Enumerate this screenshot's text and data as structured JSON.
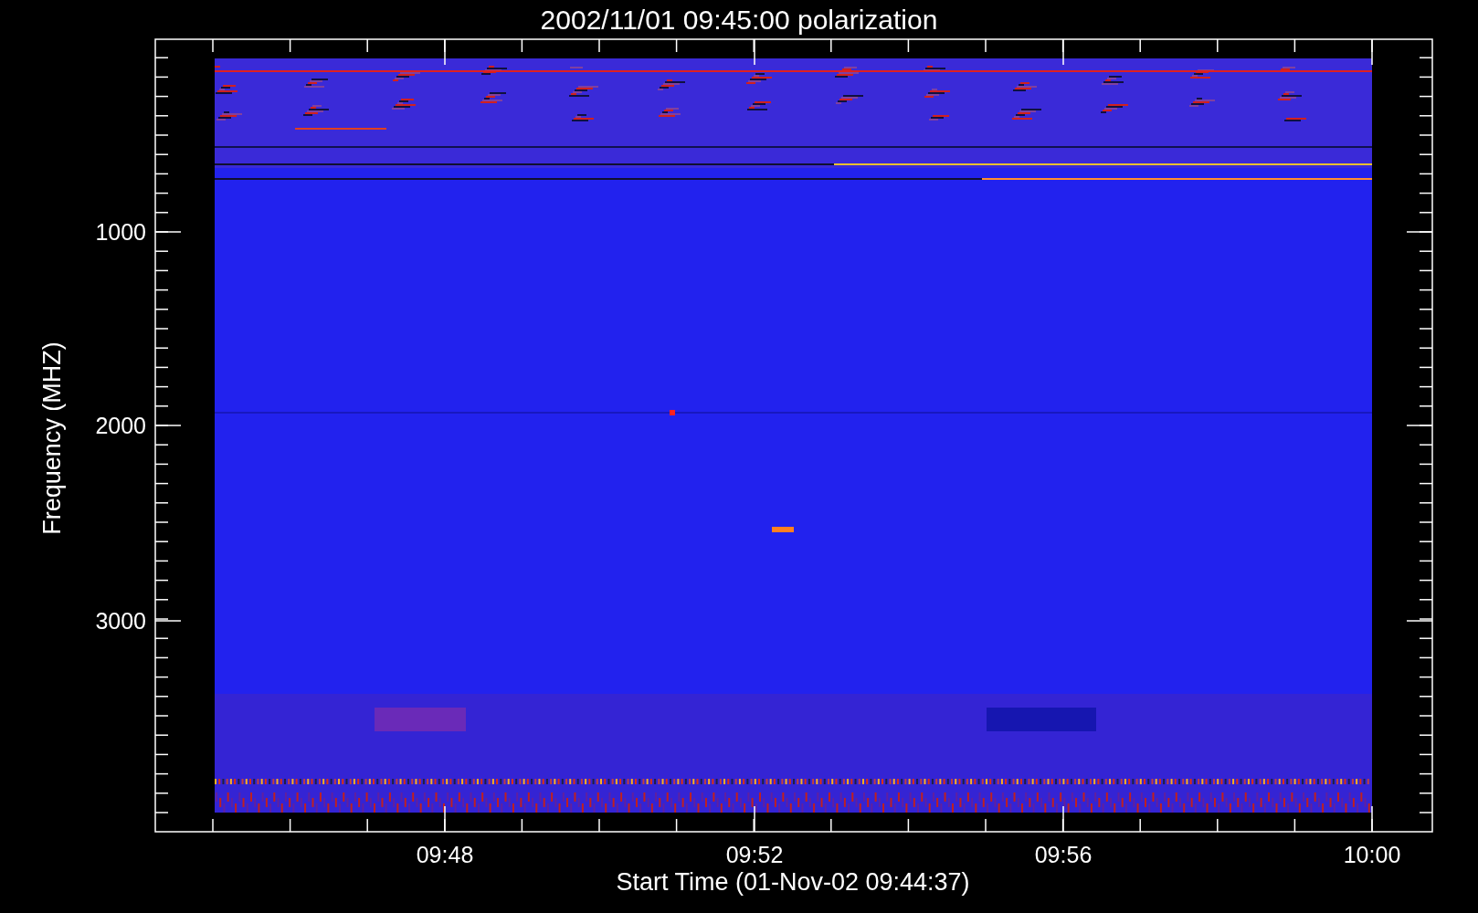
{
  "title": "2002/11/01 09:45:00 polarization",
  "y_axis": {
    "label": "Frequency (MHZ)",
    "ticks": [
      "1000",
      "2000",
      "3000"
    ]
  },
  "x_axis": {
    "label": "Start Time (01-Nov-02 09:44:37)",
    "ticks": [
      "09:48",
      "09:52",
      "09:56",
      "10:00"
    ]
  }
}
